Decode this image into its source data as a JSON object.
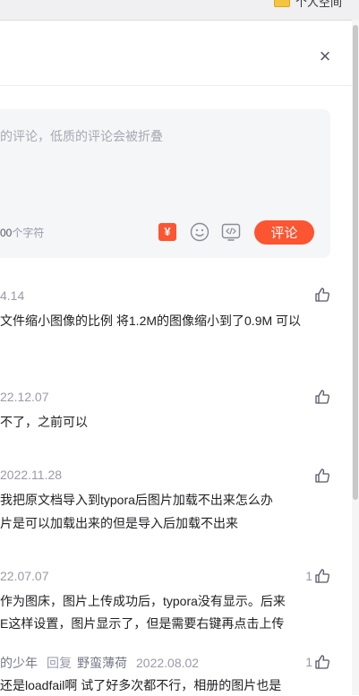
{
  "topbar": {
    "partial_text": "个人空间"
  },
  "panel": {
    "close_label": "×"
  },
  "editor": {
    "placeholder": "的评论，低质的评论会被折叠",
    "char_count_num": "00",
    "char_count_suffix": "个字符",
    "reward_symbol": "¥",
    "submit_label": "评论"
  },
  "comments": [
    {
      "date": "4.14",
      "lines": [
        "文件缩小图像的比例 将1.2M的图像缩小到了0.9M 可以"
      ],
      "likes": ""
    },
    {
      "date": "22.12.07",
      "lines": [
        "不了，之前可以"
      ],
      "likes": ""
    },
    {
      "date": "2022.11.28",
      "lines": [
        "我把原文档导入到typora后图片加载不出来怎么办",
        "片是可以加载出来的但是导入后加载不出来"
      ],
      "likes": ""
    },
    {
      "date": "22.07.07",
      "lines": [
        "作为图床，图片上传成功后，typora没有显示。后来",
        "E这样设置，图片显示了，但是需要右键再点击上传"
      ],
      "likes": "1"
    },
    {
      "author": "的少年",
      "reply_label": "回复",
      "target": "野蛮薄荷",
      "date": "2022.08.02",
      "lines": [
        "还是loadfail啊 试了好多次都不行，相册的图片也是"
      ],
      "likes": "1"
    }
  ],
  "colors": {
    "accent": "#fc5531",
    "meta": "#999aaa",
    "text": "#222226"
  }
}
